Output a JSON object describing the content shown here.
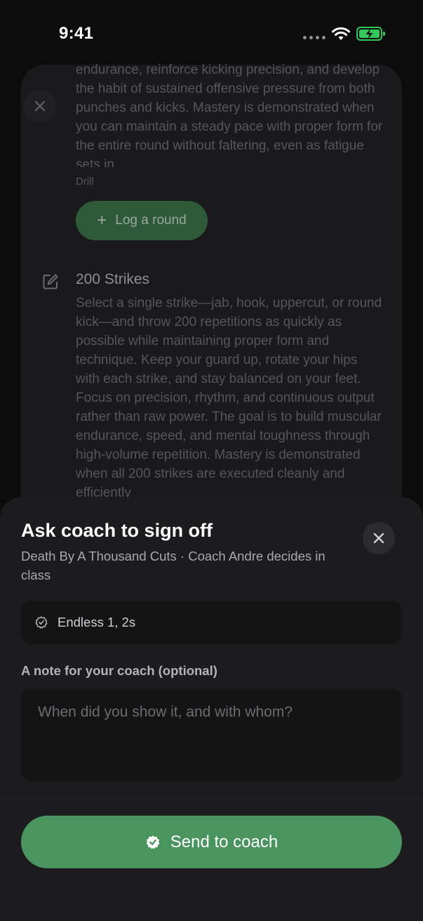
{
  "status_bar": {
    "time": "9:41"
  },
  "background": {
    "description_1": "endurance, reinforce kicking precision, and develop the habit of sustained offensive pressure from both punches and kicks. Mastery is demonstrated when you can maintain a steady pace with proper form for the entire round without faltering, even as fatigue sets in.",
    "drill_label": "Drill",
    "log_button_label": "Log a round",
    "strike_title": "200 Strikes",
    "description_2": "Select a single strike—jab, hook, uppercut, or round kick—and throw 200 repetitions as quickly as possible while maintaining proper form and technique. Keep your guard up, rotate your hips with each strike, and stay balanced on your feet. Focus on precision, rhythm, and continuous output rather than raw power. The goal is to build muscular endurance, speed, and mental toughness through high-volume repetition. Mastery is demonstrated when all 200 strikes are executed cleanly and efficiently"
  },
  "sheet": {
    "title": "Ask coach to sign off",
    "subtitle": "Death By A Thousand Cuts · Coach Andre decides in class",
    "info_text": "Endless 1, 2s",
    "note_label": "A note for your coach (optional)",
    "note_placeholder": "When did you show it, and with whom?",
    "note_value": "",
    "send_label": "Send to coach"
  },
  "colors": {
    "accent": "#4a9460",
    "sheet_background": "#1c1c1e",
    "battery": "#34c759"
  }
}
